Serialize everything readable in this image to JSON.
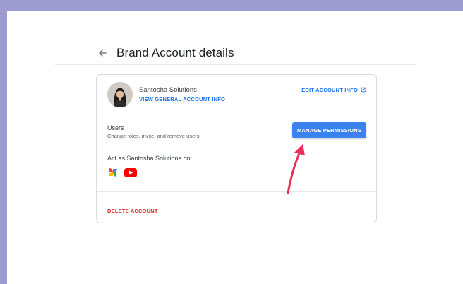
{
  "header": {
    "title": "Brand Account details",
    "back_icon": "arrow-left-icon"
  },
  "account": {
    "name": "Santosha Solutions",
    "view_info_label": "VIEW GENERAL ACCOUNT INFO",
    "edit_info_label": "EDIT ACCOUNT INFO",
    "edit_icon": "open-in-new-icon"
  },
  "users": {
    "title": "Users",
    "subtitle": "Change roles, invite, and remove users",
    "manage_label": "MANAGE PERMISSIONS"
  },
  "act_as": {
    "label": "Act as Santosha Solutions on:",
    "apps": [
      "google-photos-icon",
      "youtube-icon"
    ]
  },
  "delete_label": "DELETE ACCOUNT",
  "colors": {
    "accent": "#3b82f0",
    "link": "#1a73e8",
    "danger": "#d93025",
    "annotation": "#e8305a",
    "page_border": "#9d9bcf"
  }
}
